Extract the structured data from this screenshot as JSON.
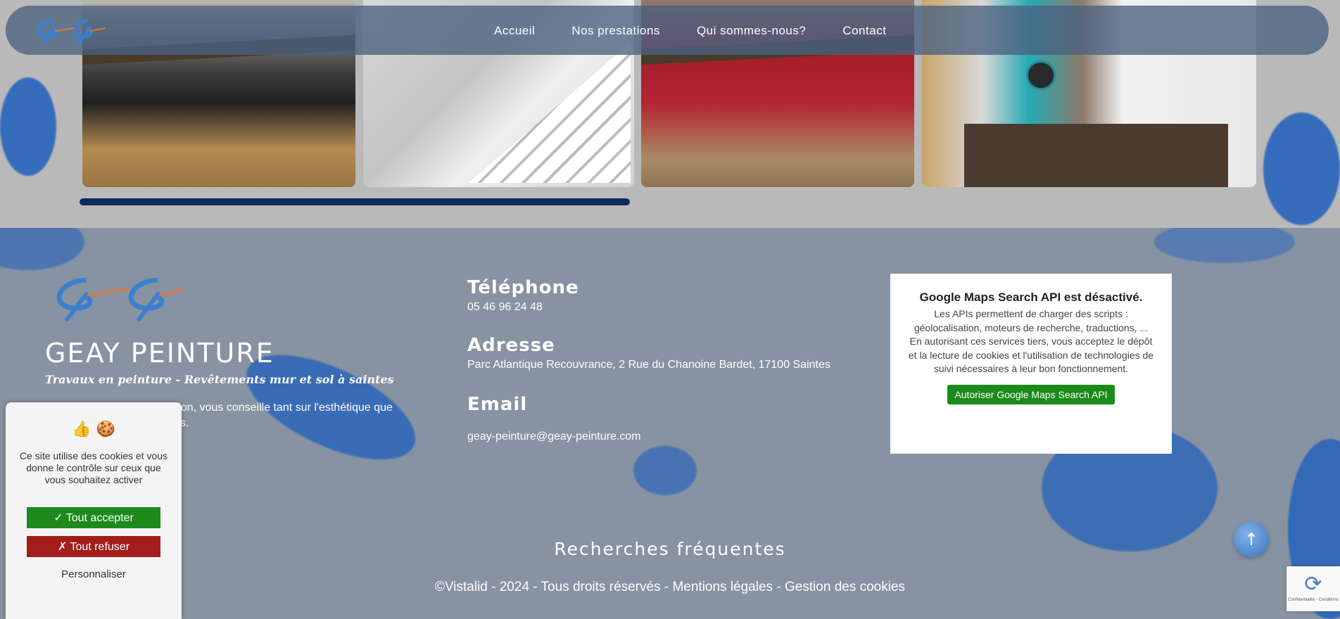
{
  "nav": {
    "items": [
      {
        "label": "Accueil"
      },
      {
        "label": "Nos prestations"
      },
      {
        "label": "Qui sommes-nous?"
      },
      {
        "label": "Contact"
      }
    ]
  },
  "brand": {
    "name": "GEAY PEINTURE",
    "tagline": "Travaux en peinture - Revêtements mur et sol à saintes",
    "description_visible": "ation, vous conseille tant sur l'esthétique que",
    "description_visible_line2": "s."
  },
  "contact": {
    "phone_heading": "Téléphone",
    "phone": "05 46 96 24 48",
    "address_heading": "Adresse",
    "address": "Parc Atlantique Recouvrance, 2 Rue du Chanoine Bardet, 17100 Saintes",
    "email_heading": "Email",
    "email": "geay-peinture@geay-peinture.com"
  },
  "maps": {
    "title": "Google Maps Search API est désactivé.",
    "text1": "Les APIs permettent de charger des scripts : géolocalisation, moteurs de recherche, traductions, ...",
    "text2": "En autorisant ces services tiers, vous acceptez le dépôt et la lecture de cookies et l'utilisation de technologies de suivi nécessaires à leur bon fonctionnement.",
    "button": "Autoriser Google Maps Search API"
  },
  "footer": {
    "searches_title": "Recherches fréquentes",
    "copyright": "©Vistalid - 2024 - Tous droits réservés - ",
    "legal_link": "Mentions légales",
    "separator": " -  ",
    "cookies_link": "Gestion des cookies"
  },
  "cookie_banner": {
    "emoji": "👍 🍪",
    "message": "Ce site utilise des cookies et vous donne le contrôle sur ceux que vous souhaitez activer",
    "accept": "✓ Tout accepter",
    "refuse": "✗ Tout refuser",
    "customize": "Personnaliser"
  },
  "scroll_top": {
    "icon": "arrow-up-icon",
    "glyph": "↑"
  },
  "recaptcha": {
    "text": "Confidentialité - Conditions"
  },
  "colors": {
    "navbar": "#4a6280",
    "footer_bg": "#8793a2",
    "progress": "#0e2a5a",
    "accept": "#1d8a1d",
    "refuse": "#a31d1d",
    "maps_button": "#1a8a1a"
  }
}
